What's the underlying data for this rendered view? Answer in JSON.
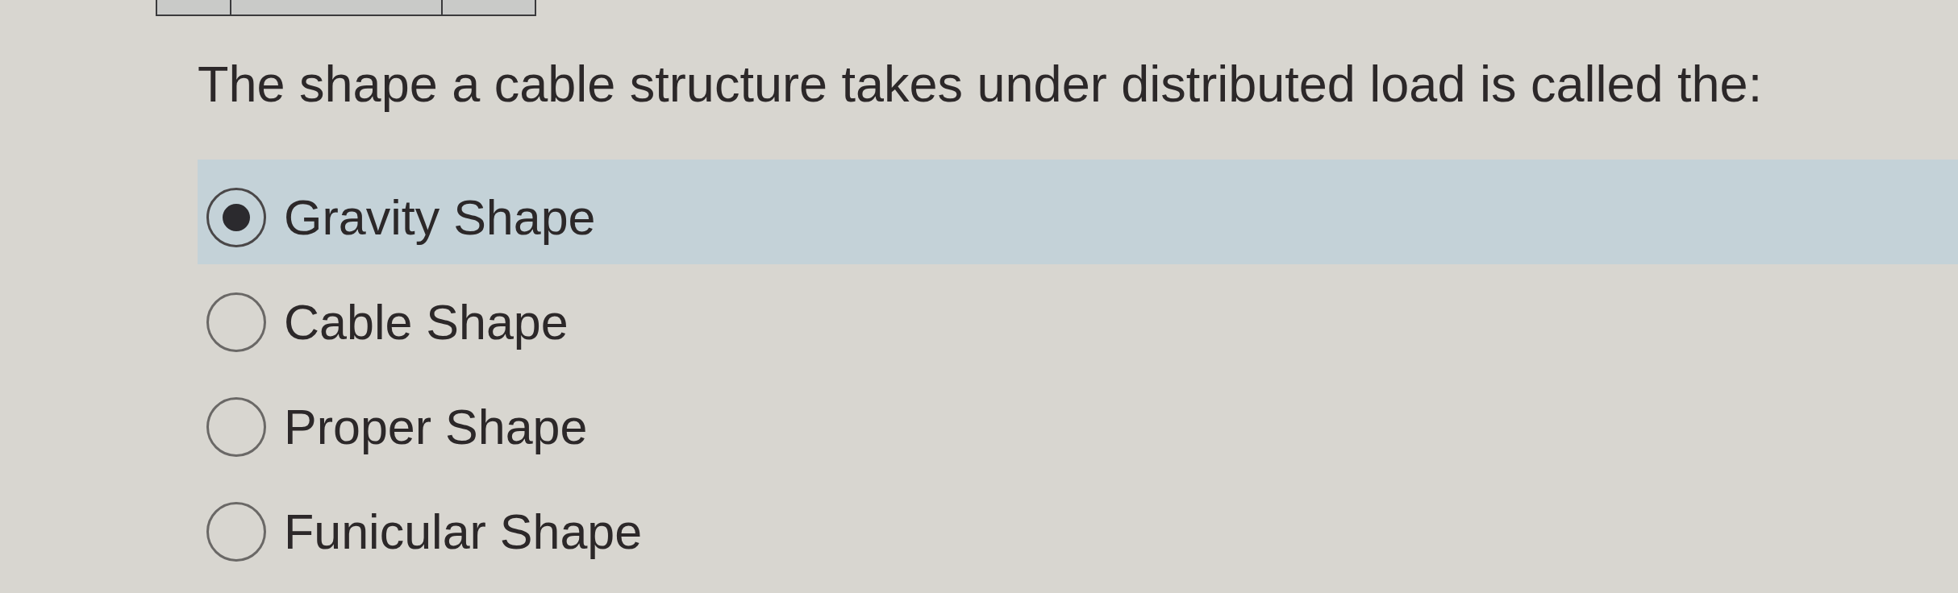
{
  "question": {
    "text": "The shape a cable structure takes under distributed load is called the:"
  },
  "options": [
    {
      "label": "Gravity Shape",
      "selected": true
    },
    {
      "label": "Cable Shape",
      "selected": false
    },
    {
      "label": "Proper Shape",
      "selected": false
    },
    {
      "label": "Funicular Shape",
      "selected": false
    }
  ]
}
